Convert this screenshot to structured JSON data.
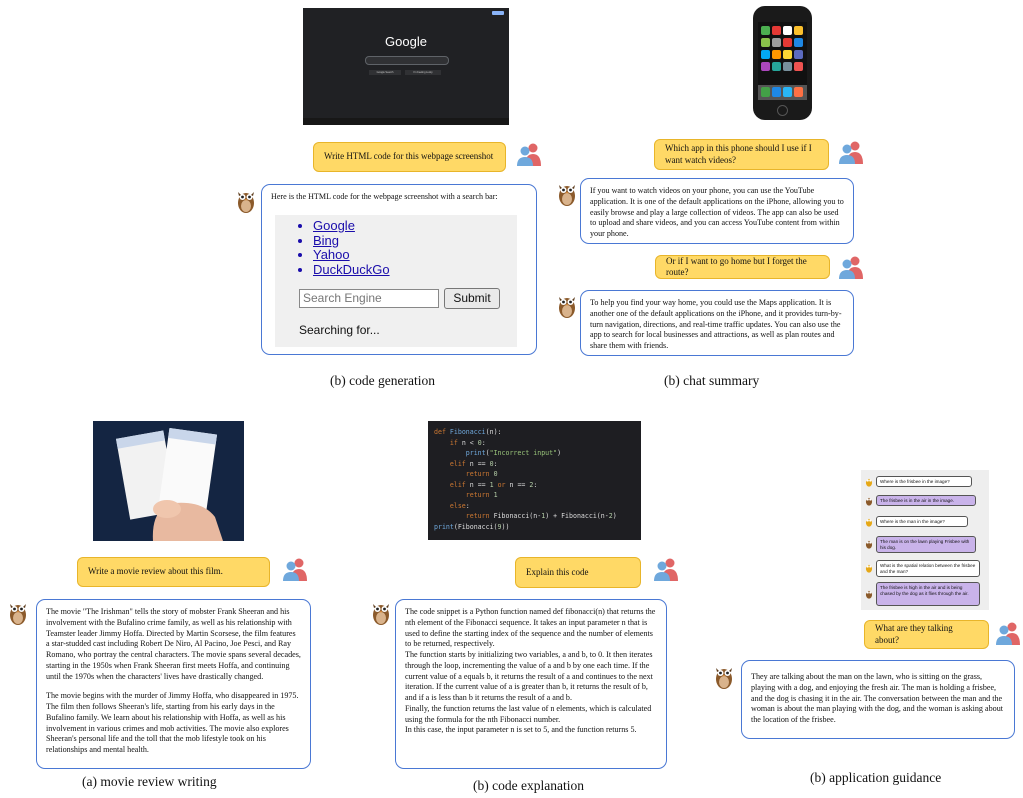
{
  "panels": {
    "code_generation": {
      "screenshot": {
        "logo": "Google",
        "btn1": "Google Search",
        "btn2": "I'm Feeling Lucky"
      },
      "prompt": "Write HTML code for this webpage screenshot",
      "response_intro": "Here is the HTML code for the webpage screenshot with a search bar:",
      "links": [
        "Google",
        "Bing",
        "Yahoo",
        "DuckDuckGo"
      ],
      "search_placeholder": "Search Engine",
      "submit_label": "Submit",
      "status": "Searching for...",
      "caption": "(b) code generation"
    },
    "chat_summary": {
      "prompt1": "Which app in this phone should I use if I want watch videos?",
      "response1": "If you want to watch videos on your phone, you can use the YouTube application. It is one of the default applications on the iPhone, allowing you to easily browse and play a large collection of videos. The app can also be used to upload and share videos, and you can access YouTube content from within your phone.",
      "prompt2": "Or if I want to go home but I forget the route?",
      "response2": "To help you find your way home, you could use the Maps application. It is another one of the default applications on the iPhone, and it provides turn-by-turn navigation, directions, and real-time traffic updates. You can also use the app to search for local businesses and attractions, as well as plan routes and share them with friends.",
      "caption": "(b) chat summary"
    },
    "movie_review": {
      "prompt": "Write a movie review about this film.",
      "para1": "The movie \"The Irishman\" tells the story of mobster Frank Sheeran and his involvement with the Bufalino crime family, as well as his relationship with Teamster leader Jimmy Hoffa. Directed by Martin Scorsese, the film features a star-studded cast including Robert De Niro, Al Pacino, Joe Pesci, and Ray Romano, who portray the central characters. The movie spans several decades, starting in the 1950s when Frank Sheeran first meets Hoffa, and continuing until the 1970s when the characters' lives have drastically changed.",
      "para2": "The movie begins with the murder of Jimmy Hoffa, who disappeared in 1975. The film then follows Sheeran's life, starting from his early days in the Bufalino family. We learn about his relationship with Hoffa, as well as his involvement in various crimes and mob activities. The movie also explores Sheeran's personal life and the toll that the mob lifestyle took on his relationships and mental health.",
      "caption": "(a) movie review writing"
    },
    "code_explanation": {
      "prompt": "Explain this code",
      "lines": [
        "The code snippet is a Python function named def fibonacci(n) that returns the nth element of the Fibonacci sequence. It takes an input parameter n that is used to define the starting index of the sequence and the number of elements to be returned, respectively.",
        "The function starts by initializing two variables, a and b, to 0. It then iterates through the loop, incrementing the value of a and b by one each time. If the current value of a equals b, it returns the result of a and continues to the next iteration. If the current value of a is greater than b, it returns the result of b, and if a is less than b it returns the result of a and b.",
        "Finally, the function returns the last value of n elements, which is calculated using the formula for the nth Fibonacci number.",
        "In this case, the input parameter n is set to 5, and the function returns 5."
      ],
      "caption": "(b) code explanation"
    },
    "application_guidance": {
      "thumb": [
        "Where is the frisbee in the image?",
        "The frisbee is in the air in the image.",
        "Where is the man in the image?",
        "The man is on the lawn playing Frisbee with his dog.",
        "What is the spatial relation between the frisbee and the man?",
        "The frisbee is high in the air and is being chased by the dog as it flies through the air."
      ],
      "prompt": "What are they talking about?",
      "response": "They are talking about the man on the lawn, who is sitting on the grass, playing with a dog, and enjoying the fresh air. The man is holding a frisbee, and the dog is chasing it in the air. The conversation between the man and the woman is about the man playing with the dog, and the woman is asking about the location of the frisbee.",
      "caption": "(b) application guidance"
    }
  },
  "colors": {
    "user_bubble": "#ffd966",
    "bot_border": "#4a78d4"
  }
}
